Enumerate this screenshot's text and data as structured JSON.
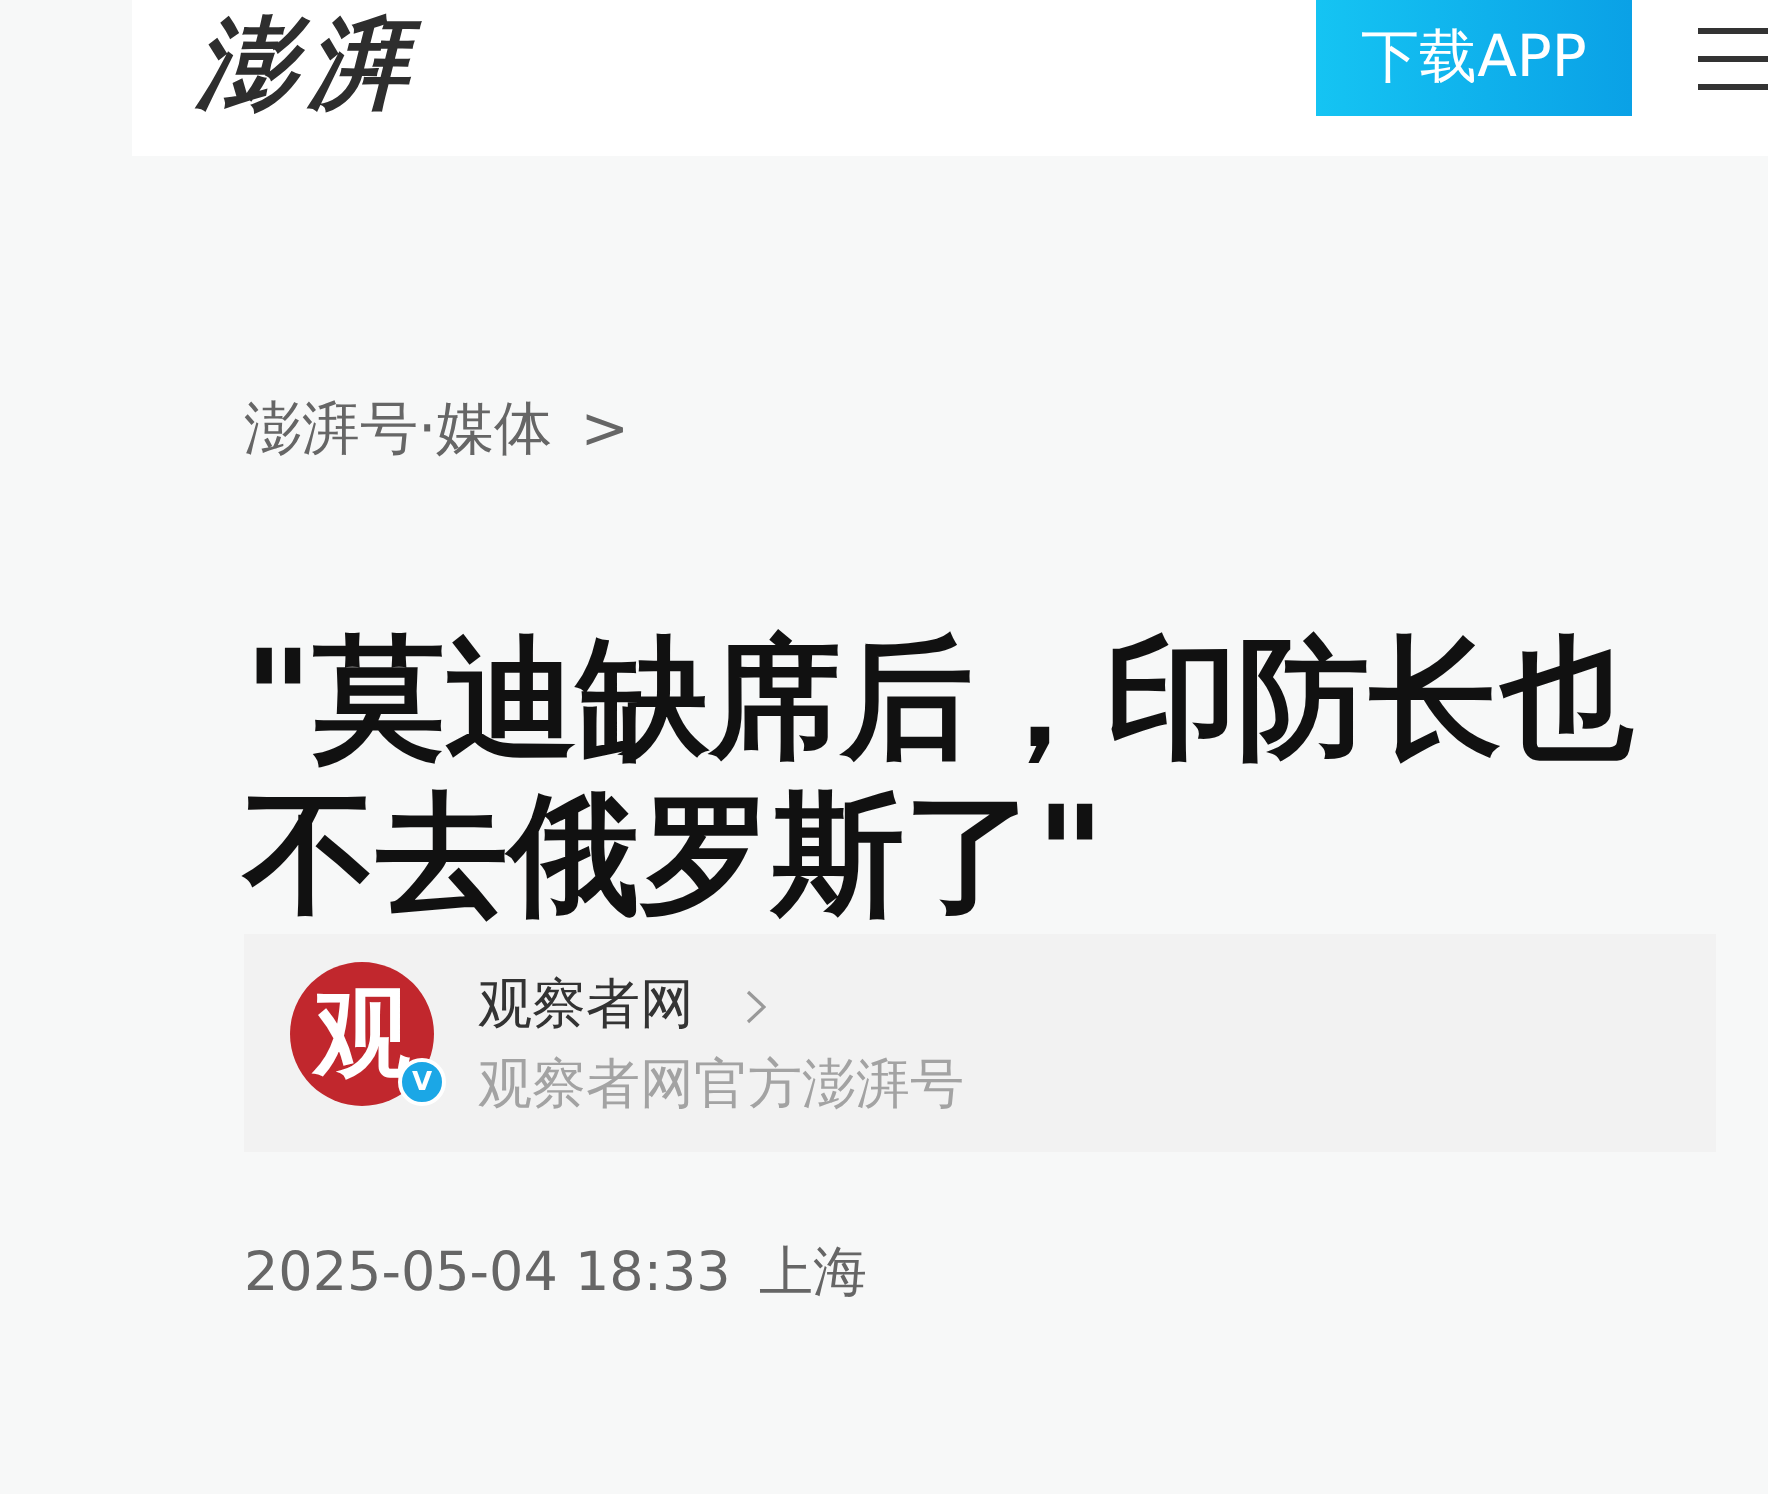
{
  "header": {
    "logo": "澎湃",
    "download_button": "下载APP"
  },
  "breadcrumb": {
    "label": "澎湃号·媒体",
    "chevron": ">"
  },
  "title": "\"莫迪缺席后，印防长也不去俄罗斯了\"",
  "author": {
    "avatar_text": "观",
    "verified": true,
    "verified_label": "V",
    "name": "观察者网",
    "description": "观察者网官方澎湃号"
  },
  "meta": {
    "date": "2025-05-04 18:33",
    "location": "上海"
  }
}
